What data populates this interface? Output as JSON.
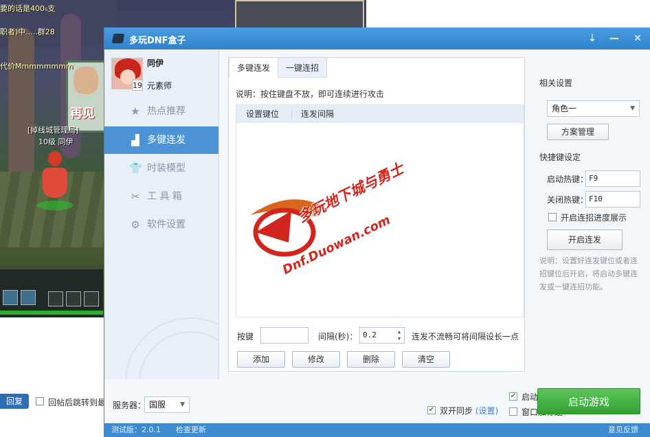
{
  "background": {
    "chat_lines": [
      "要的话是400₅支",
      "职者)中.....群28",
      "代价Mmmmmmmm"
    ],
    "char_guild": "[掉线城管理局]",
    "char_level": "10级",
    "char_name": "同伊",
    "billboard_text": "再见",
    "forum_reply_label": "回复",
    "forum_after_reply_label": "回帖后跳转到最"
  },
  "window": {
    "title": "多玩DNF盒子",
    "controls": {
      "skin_icon": "down-arrow-icon",
      "minimize": "—",
      "close": "✕"
    }
  },
  "user": {
    "name": "同伊",
    "level": "19",
    "class": "元素师"
  },
  "nav": {
    "items": [
      {
        "icon": "star-icon",
        "glyph": "★",
        "label": "热点推荐",
        "active": false
      },
      {
        "icon": "bars-icon",
        "glyph": "▟",
        "label": "多键连发",
        "active": true
      },
      {
        "icon": "shirt-icon",
        "glyph": "👕",
        "label": "时装模型",
        "active": false
      },
      {
        "icon": "tools-icon",
        "glyph": "✂",
        "label": "工 具 箱",
        "active": false
      },
      {
        "icon": "gear-icon",
        "glyph": "⚙",
        "label": "软件设置",
        "active": false
      }
    ]
  },
  "tabs": [
    {
      "label": "多键连发",
      "active": true
    },
    {
      "label": "一键连招",
      "active": false
    }
  ],
  "panel": {
    "description": "说明：按住键盘不放，即可连续进行攻击",
    "columns": [
      "设置键位",
      "连发间隔"
    ],
    "watermark_line1": "多玩地下城与勇士",
    "watermark_line2": "Dnf.Duowan.com",
    "key_label": "按键",
    "key_value": "",
    "interval_label": "间隔(秒)：",
    "interval_value": "0.2",
    "interval_hint": "连发不流畅可将间隔设长一点",
    "buttons": {
      "add": "添加",
      "edit": "修改",
      "delete": "删除",
      "clear": "清空"
    }
  },
  "settings": {
    "section_title": "相关设置",
    "role_selected": "角色一",
    "plan_button": "方案管理",
    "hotkey_title": "快捷键设定",
    "start_hotkey_label": "启动热键：",
    "start_hotkey_value": "F9",
    "stop_hotkey_label": "关闭热键：",
    "stop_hotkey_value": "F10",
    "progress_checkbox_label": "开启连招进度展示",
    "progress_checked": false,
    "start_button": "开启连发",
    "note": "说明：设置好连发键位或者连招键位后开启，将启动多键连发或一键连招功能。"
  },
  "bottom": {
    "server_label": "服务器：",
    "server_selected": "国服",
    "dual_sync_label": "双开同步",
    "dual_sync_link": "(设置)",
    "dual_sync_checked": true,
    "dual_open_label": "启动双开",
    "dual_open_checked": true,
    "window_title_label": "窗口加标题",
    "window_title_checked": false,
    "launch_button": "启动游戏"
  },
  "status": {
    "version_label": "测试版：2.0.1",
    "check_update": "检查更新",
    "feedback": "意见反馈"
  },
  "colors": {
    "titlebar": "#3a8fd6",
    "nav_active": "#4d94d6",
    "launch_green": "#43b443",
    "watermark_red": "#d0261e"
  }
}
